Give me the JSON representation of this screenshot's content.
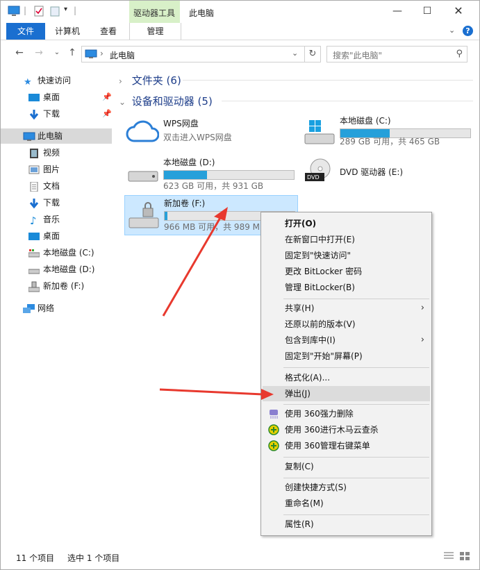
{
  "window": {
    "title": "此电脑",
    "context_tab_header": "驱动器工具"
  },
  "ribbon": {
    "tabs": [
      {
        "label": "文件"
      },
      {
        "label": "计算机"
      },
      {
        "label": "查看"
      },
      {
        "label": "管理"
      }
    ]
  },
  "address": {
    "path": "此电脑",
    "search_placeholder": "搜索\"此电脑\""
  },
  "sidebar": {
    "items": [
      {
        "label": "快速访问",
        "icon": "star-icon"
      },
      {
        "label": "桌面",
        "icon": "desktop-icon"
      },
      {
        "label": "下载",
        "icon": "download-icon"
      },
      {
        "label": "此电脑",
        "icon": "pc-icon"
      },
      {
        "label": "视频",
        "icon": "video-icon"
      },
      {
        "label": "图片",
        "icon": "picture-icon"
      },
      {
        "label": "文档",
        "icon": "document-icon"
      },
      {
        "label": "下载",
        "icon": "download-icon"
      },
      {
        "label": "音乐",
        "icon": "music-icon"
      },
      {
        "label": "桌面",
        "icon": "desktop-icon"
      },
      {
        "label": "本地磁盘 (C:)",
        "icon": "drive-icon"
      },
      {
        "label": "本地磁盘 (D:)",
        "icon": "drive-icon"
      },
      {
        "label": "新加卷 (F:)",
        "icon": "usb-drive-icon"
      },
      {
        "label": "网络",
        "icon": "network-icon"
      }
    ]
  },
  "groups": {
    "folders": "文件夹 (6)",
    "devices": "设备和驱动器 (5)"
  },
  "drives": [
    {
      "name": "WPS网盘",
      "sub": "双击进入WPS网盘"
    },
    {
      "name": "本地磁盘 (C:)",
      "sub": "289 GB 可用，共 465 GB",
      "used_fraction": 0.38
    },
    {
      "name": "本地磁盘 (D:)",
      "sub": "623 GB 可用，共 931 GB",
      "used_fraction": 0.33
    },
    {
      "name": "DVD 驱动器 (E:)"
    },
    {
      "name": "新加卷 (F:)",
      "sub": "966 MB 可用，共 989 MB",
      "used_fraction": 0.02
    }
  ],
  "context_menu": {
    "items": [
      {
        "label": "打开(O)"
      },
      {
        "label": "在新窗口中打开(E)"
      },
      {
        "label": "固定到\"快速访问\""
      },
      {
        "label": "更改 BitLocker 密码"
      },
      {
        "label": "管理 BitLocker(B)"
      },
      {
        "label": "共享(H)"
      },
      {
        "label": "还原以前的版本(V)"
      },
      {
        "label": "包含到库中(I)"
      },
      {
        "label": "固定到\"开始\"屏幕(P)"
      },
      {
        "label": "格式化(A)..."
      },
      {
        "label": "弹出(J)"
      },
      {
        "label": "使用 360强力删除"
      },
      {
        "label": "使用 360进行木马云查杀"
      },
      {
        "label": "使用 360管理右键菜单"
      },
      {
        "label": "复制(C)"
      },
      {
        "label": "创建快捷方式(S)"
      },
      {
        "label": "重命名(M)"
      },
      {
        "label": "属性(R)"
      }
    ]
  },
  "status": {
    "count": "11 个项目",
    "selected": "选中 1 个项目"
  },
  "colors": {
    "accent": "#1a6fd0",
    "bar_fill": "#26a0da",
    "annotation_arrow": "#e8392e"
  }
}
